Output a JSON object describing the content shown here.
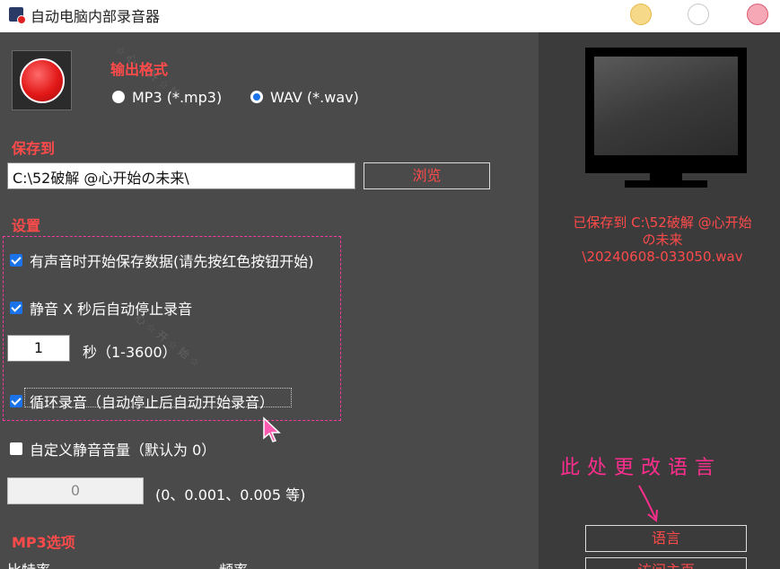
{
  "window": {
    "title": "自动电脑内部录音器"
  },
  "output_format": {
    "label": "输出格式",
    "options": [
      {
        "label": "MP3 (*.mp3)",
        "selected": false
      },
      {
        "label": "WAV (*.wav)",
        "selected": true
      }
    ]
  },
  "save_to": {
    "label": "保存到",
    "path": "C:\\52破解 @心开始の未来\\",
    "browse_label": "浏览"
  },
  "settings": {
    "label": "设置",
    "start_on_sound": {
      "label": "有声音时开始保存数据(请先按红色按钮开始)",
      "checked": true
    },
    "auto_stop": {
      "label": "静音 X 秒后自动停止录音",
      "checked": true
    },
    "seconds_value": "1",
    "seconds_label": "秒（1-3600）",
    "loop": {
      "label": "循环录音（自动停止后自动开始录音）",
      "checked": true
    },
    "custom_silence": {
      "label": "自定义静音音量（默认为 0）",
      "checked": false
    },
    "silence_value": "0",
    "silence_hint": "(0、0.001、0.005 等)"
  },
  "mp3_options": {
    "label": "MP3选项",
    "bitrate_label": "比特率",
    "frequency_label": "频率"
  },
  "status": {
    "saved_line1": "已保存到 C:\\52破解 @心开始",
    "saved_line2": "の未来",
    "saved_line3": "\\20240608-033050.wav"
  },
  "annotation": "此处更改语言",
  "sidebar": {
    "language_label": "语言",
    "homepage_label": "访问主页"
  },
  "colors": {
    "accent_red": "#ff4a4a",
    "annotation_pink": "#ff2e8e",
    "checkbox_blue": "#1a73e8"
  }
}
